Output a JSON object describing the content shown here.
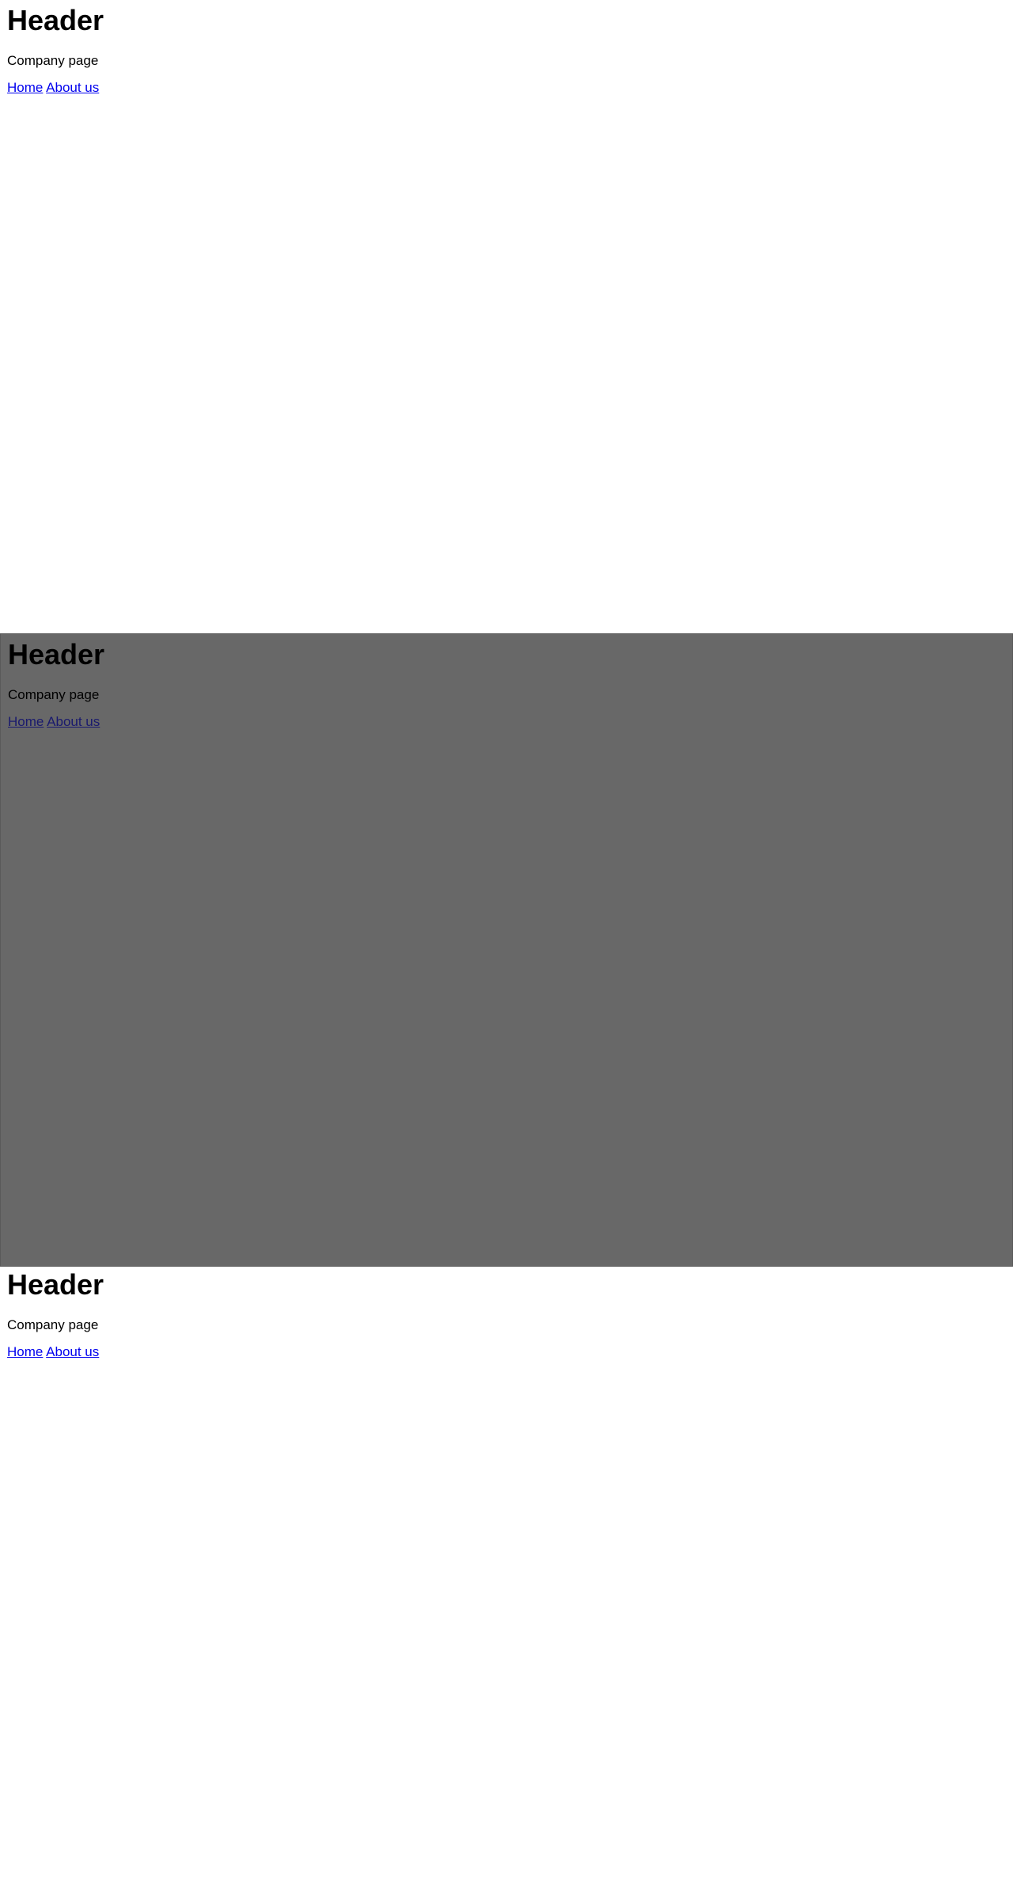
{
  "sections": [
    {
      "header": "Header",
      "subtitle": "Company page",
      "nav": {
        "home": "Home",
        "about": "About us"
      }
    },
    {
      "header": "Header",
      "subtitle": "Company page",
      "nav": {
        "home": "Home",
        "about": "About us"
      },
      "background": "#686868"
    },
    {
      "header": "Header",
      "subtitle": "Company page",
      "nav": {
        "home": "Home",
        "about": "About us"
      }
    }
  ],
  "colors": {
    "link": "#0000ee",
    "overlay": "#686868",
    "text": "#000000"
  }
}
